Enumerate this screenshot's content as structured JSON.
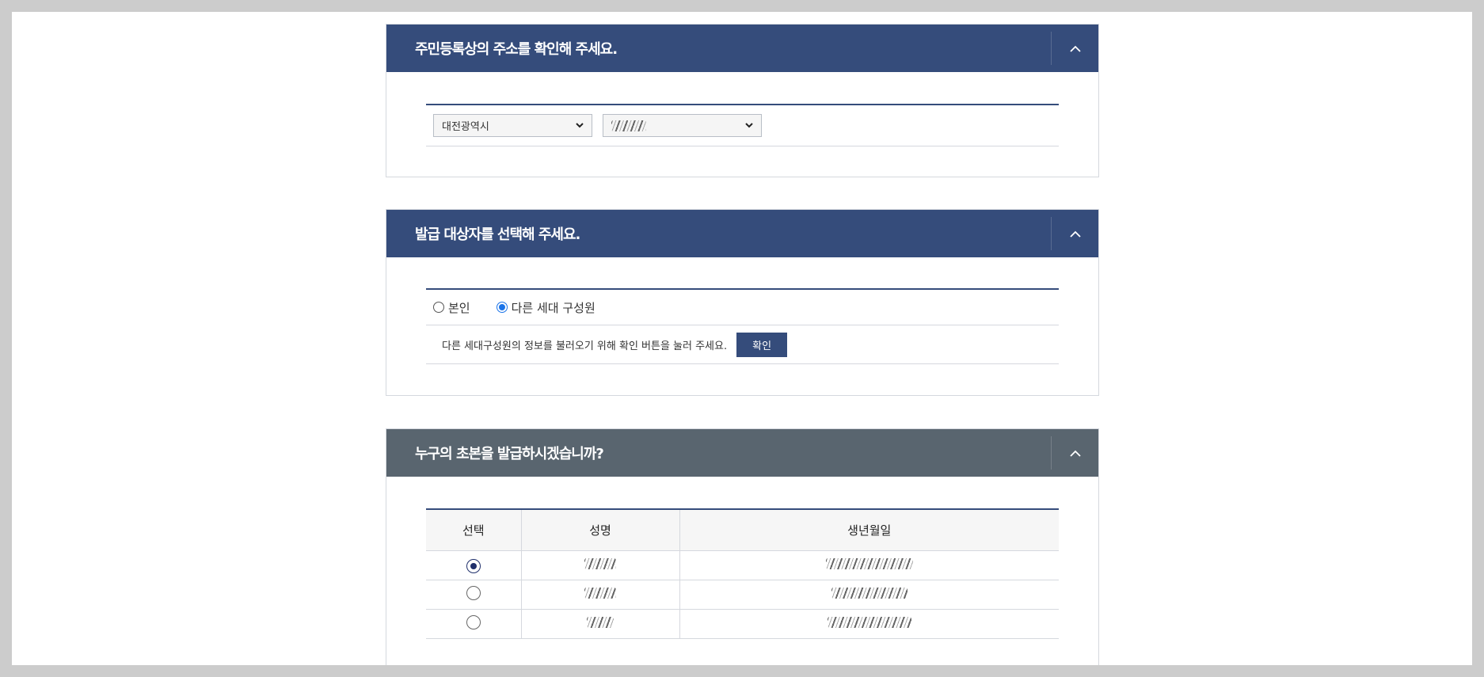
{
  "colors": {
    "header_blue": "#354c7b",
    "header_gray": "#59656f",
    "radio_blue": "#1a73e8"
  },
  "address_section": {
    "title": "주민등록상의 주소를 확인해 주세요.",
    "toggle_icon": "chevron-up-icon",
    "city_select": {
      "value": "대전광역시"
    },
    "district_select": {
      "value": ""
    }
  },
  "target_section": {
    "title": "발급 대상자를 선택해 주세요.",
    "toggle_icon": "chevron-up-icon",
    "options": [
      {
        "label": "본인",
        "checked": false
      },
      {
        "label": "다른 세대 구성원",
        "checked": true
      }
    ],
    "help_text": "다른 세대구성원의 정보를 불러오기 위해 확인 버튼을 눌러 주세요.",
    "confirm_label": "확인"
  },
  "member_section": {
    "title": "누구의 초본을 발급하시겠습니까?",
    "toggle_icon": "chevron-up-icon",
    "columns": [
      "선택",
      "성명",
      "생년월일"
    ],
    "rows": [
      {
        "selected": true,
        "name": "",
        "birth": ""
      },
      {
        "selected": false,
        "name": "",
        "birth": ""
      },
      {
        "selected": false,
        "name": "",
        "birth": ""
      }
    ]
  }
}
